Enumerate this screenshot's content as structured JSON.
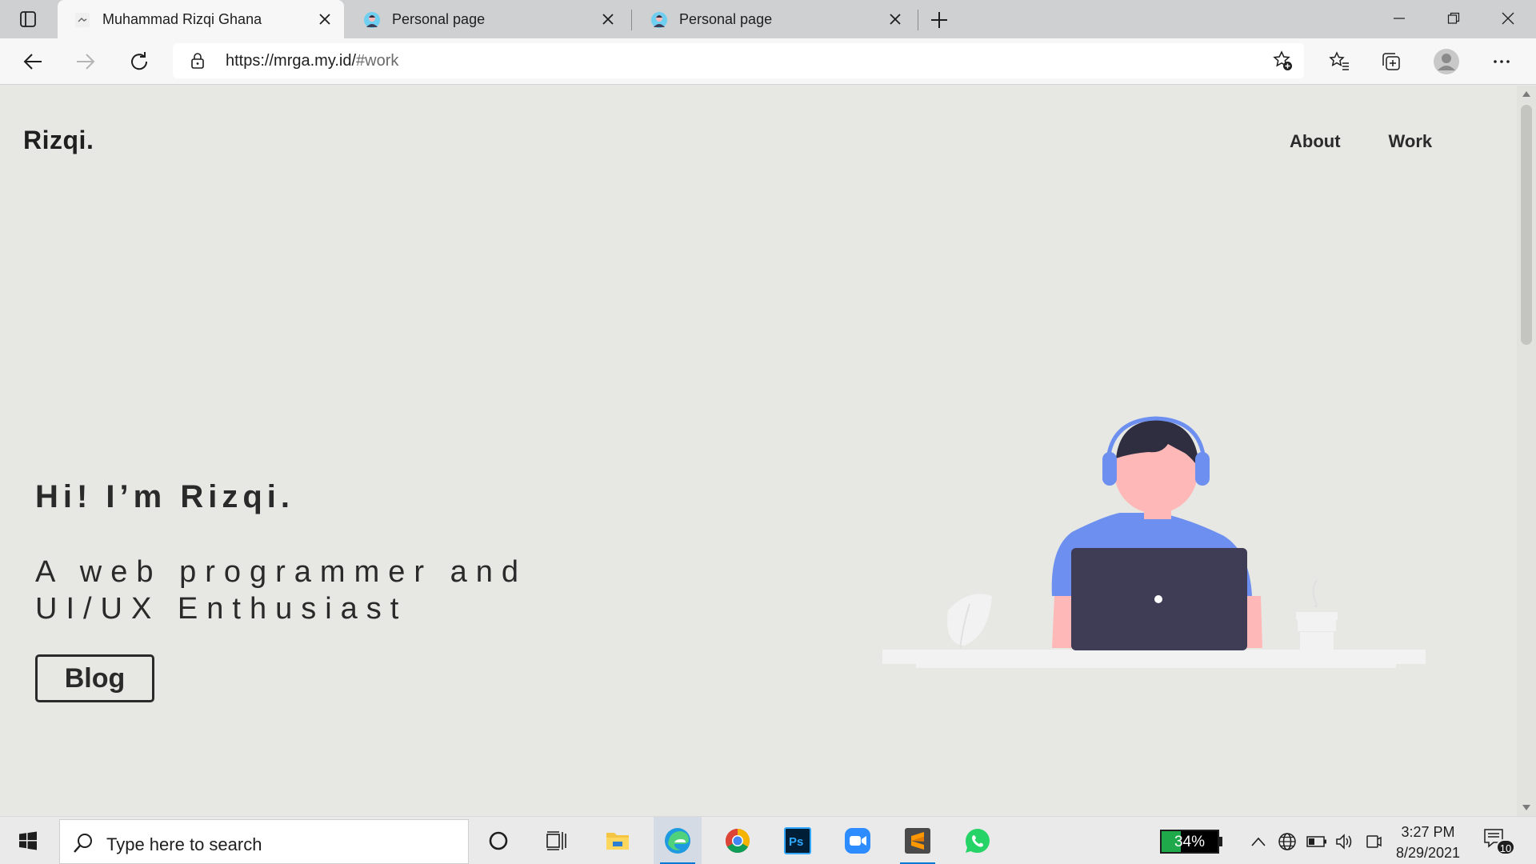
{
  "browser": {
    "tabs": [
      {
        "title": "Muhammad Rizqi Ghana",
        "active": true,
        "favicon": "site-favicon"
      },
      {
        "title": "Personal page",
        "active": false,
        "favicon": "avatar-favicon"
      },
      {
        "title": "Personal page",
        "active": false,
        "favicon": "avatar-favicon"
      }
    ],
    "address": {
      "host": "https://mrga.my.id/",
      "path": "#work"
    }
  },
  "site": {
    "logo": "Rizqi.",
    "nav": [
      "About",
      "Work"
    ],
    "hero": {
      "title": "Hi! I’m Rizqi.",
      "subtitle": "A web programmer and UI/UX Enthusiast",
      "button": "Blog"
    },
    "colors": {
      "accent": "#6c8ff0",
      "dark": "#3f3d56",
      "skin": "#ffb8b8",
      "background": "#e7e8e3"
    }
  },
  "taskbar": {
    "search_placeholder": "Type here to search",
    "pinned_apps": [
      "cortana-icon",
      "task-view-icon",
      "file-explorer-icon",
      "edge-icon",
      "chrome-icon",
      "photoshop-icon",
      "zoom-icon",
      "sublime-text-icon",
      "whatsapp-icon"
    ],
    "battery": {
      "label": "34%",
      "level": 0.34
    },
    "clock": {
      "time": "3:27 PM",
      "date": "8/29/2021"
    },
    "notifications": "10"
  }
}
